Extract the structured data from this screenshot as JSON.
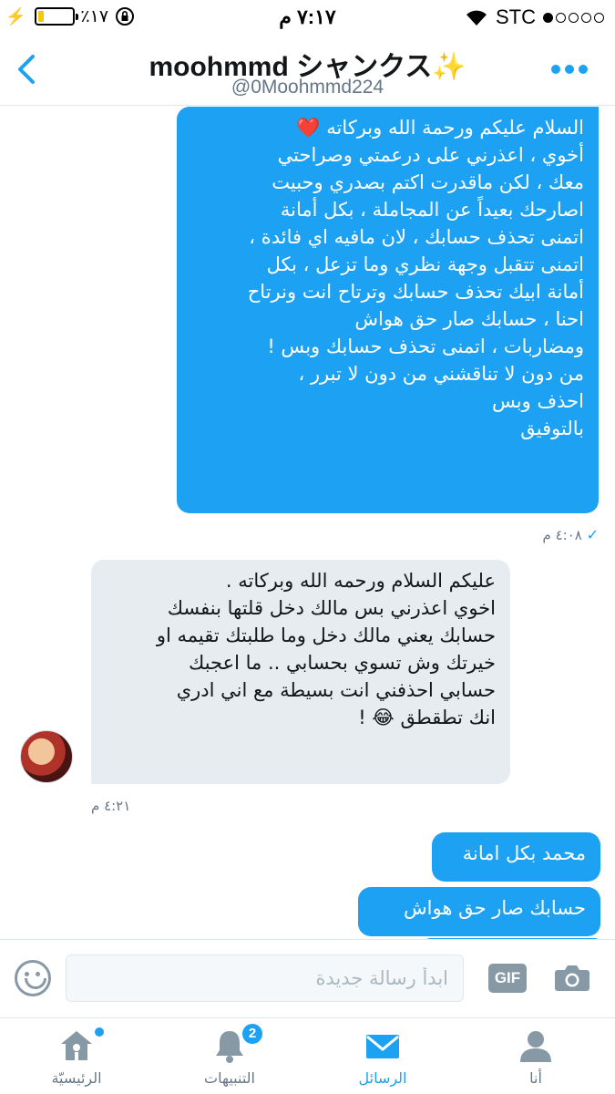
{
  "status_bar": {
    "battery": "٪١٧",
    "battery_level": 0.17,
    "time": "٧:١٧ م",
    "carrier": "STC"
  },
  "header": {
    "title": "moohmmd シャンクス✨",
    "handle": "@0Moohmmd224"
  },
  "messages": [
    {
      "direction": "outgoing",
      "text": "السلام عليكم ورحمة الله وبركاته ❤️\nأخوي ، اعذرني على درعمتي وصراحتي\nمعك ، لكن ماقدرت اكتم بصدري وحبيت\nاصارحك بعيداً عن المجاملة ، بكل أمانة\nاتمنى تحذف حسابك ، لان مافيه اي فائدة ،\nاتمنى تتقبل وجهة نظري وما تزعل ، بكل\nأمانة ابيك تحذف حسابك وترتاح انت ونرتاح\nاحنا ، حسابك صار حق هواش\nومضاربات ، اتمنى تحذف حسابك وبس !\nمن دون لا تناقشني من دون لا تبرر ،\nاحذف وبس\nبالتوفيق",
      "timestamp": "٤:٠٨ م"
    },
    {
      "direction": "incoming",
      "text": "عليكم السلام ورحمه الله وبركاته .\nاخوي اعذرني بس مالك دخل قلتها بنفسك\nحسابك يعني مالك دخل وما طلبتك تقيمه او\nخيرتك وش تسوي بحسابي .. ما اعجبك\nحسابي احذفني انت بسيطة مع اني ادري\nانك تطقطق 😂 !",
      "timestamp": "٤:٢١ م"
    },
    {
      "direction": "outgoing",
      "text": "محمد بكل امانة"
    },
    {
      "direction": "outgoing",
      "text": "حسابك صار حق هواش"
    }
  ],
  "composer": {
    "placeholder": "ابدأ رسالة جديدة",
    "gif_label": "GIF"
  },
  "tabs": [
    {
      "label": "الرئيسيّة",
      "icon": "home-icon"
    },
    {
      "label": "التنبيهات",
      "icon": "bell-icon",
      "badge": "2"
    },
    {
      "label": "الرسائل",
      "icon": "envelope-icon",
      "active": true
    },
    {
      "label": "أنا",
      "icon": "person-icon"
    }
  ],
  "colors": {
    "accent": "#1da1f2",
    "incoming_bubble": "#e6ecf0",
    "muted_text": "#657786"
  }
}
